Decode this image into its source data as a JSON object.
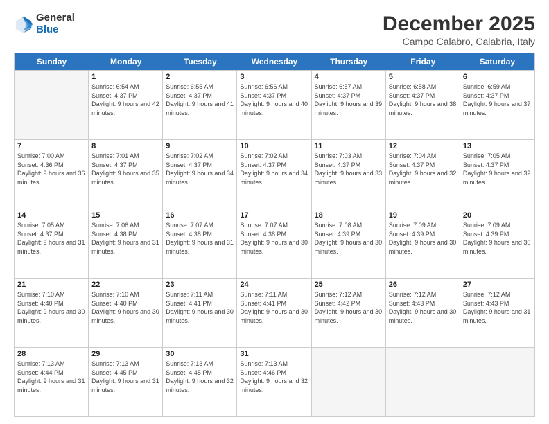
{
  "logo": {
    "general": "General",
    "blue": "Blue"
  },
  "title": "December 2025",
  "location": "Campo Calabro, Calabria, Italy",
  "header_days": [
    "Sunday",
    "Monday",
    "Tuesday",
    "Wednesday",
    "Thursday",
    "Friday",
    "Saturday"
  ],
  "weeks": [
    [
      {
        "day": "",
        "empty": true
      },
      {
        "day": "1",
        "sunrise": "6:54 AM",
        "sunset": "4:37 PM",
        "daylight": "9 hours and 42 minutes."
      },
      {
        "day": "2",
        "sunrise": "6:55 AM",
        "sunset": "4:37 PM",
        "daylight": "9 hours and 41 minutes."
      },
      {
        "day": "3",
        "sunrise": "6:56 AM",
        "sunset": "4:37 PM",
        "daylight": "9 hours and 40 minutes."
      },
      {
        "day": "4",
        "sunrise": "6:57 AM",
        "sunset": "4:37 PM",
        "daylight": "9 hours and 39 minutes."
      },
      {
        "day": "5",
        "sunrise": "6:58 AM",
        "sunset": "4:37 PM",
        "daylight": "9 hours and 38 minutes."
      },
      {
        "day": "6",
        "sunrise": "6:59 AM",
        "sunset": "4:37 PM",
        "daylight": "9 hours and 37 minutes."
      }
    ],
    [
      {
        "day": "7",
        "sunrise": "7:00 AM",
        "sunset": "4:36 PM",
        "daylight": "9 hours and 36 minutes."
      },
      {
        "day": "8",
        "sunrise": "7:01 AM",
        "sunset": "4:37 PM",
        "daylight": "9 hours and 35 minutes."
      },
      {
        "day": "9",
        "sunrise": "7:02 AM",
        "sunset": "4:37 PM",
        "daylight": "9 hours and 34 minutes."
      },
      {
        "day": "10",
        "sunrise": "7:02 AM",
        "sunset": "4:37 PM",
        "daylight": "9 hours and 34 minutes."
      },
      {
        "day": "11",
        "sunrise": "7:03 AM",
        "sunset": "4:37 PM",
        "daylight": "9 hours and 33 minutes."
      },
      {
        "day": "12",
        "sunrise": "7:04 AM",
        "sunset": "4:37 PM",
        "daylight": "9 hours and 32 minutes."
      },
      {
        "day": "13",
        "sunrise": "7:05 AM",
        "sunset": "4:37 PM",
        "daylight": "9 hours and 32 minutes."
      }
    ],
    [
      {
        "day": "14",
        "sunrise": "7:05 AM",
        "sunset": "4:37 PM",
        "daylight": "9 hours and 31 minutes."
      },
      {
        "day": "15",
        "sunrise": "7:06 AM",
        "sunset": "4:38 PM",
        "daylight": "9 hours and 31 minutes."
      },
      {
        "day": "16",
        "sunrise": "7:07 AM",
        "sunset": "4:38 PM",
        "daylight": "9 hours and 31 minutes."
      },
      {
        "day": "17",
        "sunrise": "7:07 AM",
        "sunset": "4:38 PM",
        "daylight": "9 hours and 30 minutes."
      },
      {
        "day": "18",
        "sunrise": "7:08 AM",
        "sunset": "4:39 PM",
        "daylight": "9 hours and 30 minutes."
      },
      {
        "day": "19",
        "sunrise": "7:09 AM",
        "sunset": "4:39 PM",
        "daylight": "9 hours and 30 minutes."
      },
      {
        "day": "20",
        "sunrise": "7:09 AM",
        "sunset": "4:39 PM",
        "daylight": "9 hours and 30 minutes."
      }
    ],
    [
      {
        "day": "21",
        "sunrise": "7:10 AM",
        "sunset": "4:40 PM",
        "daylight": "9 hours and 30 minutes."
      },
      {
        "day": "22",
        "sunrise": "7:10 AM",
        "sunset": "4:40 PM",
        "daylight": "9 hours and 30 minutes."
      },
      {
        "day": "23",
        "sunrise": "7:11 AM",
        "sunset": "4:41 PM",
        "daylight": "9 hours and 30 minutes."
      },
      {
        "day": "24",
        "sunrise": "7:11 AM",
        "sunset": "4:41 PM",
        "daylight": "9 hours and 30 minutes."
      },
      {
        "day": "25",
        "sunrise": "7:12 AM",
        "sunset": "4:42 PM",
        "daylight": "9 hours and 30 minutes."
      },
      {
        "day": "26",
        "sunrise": "7:12 AM",
        "sunset": "4:43 PM",
        "daylight": "9 hours and 30 minutes."
      },
      {
        "day": "27",
        "sunrise": "7:12 AM",
        "sunset": "4:43 PM",
        "daylight": "9 hours and 31 minutes."
      }
    ],
    [
      {
        "day": "28",
        "sunrise": "7:13 AM",
        "sunset": "4:44 PM",
        "daylight": "9 hours and 31 minutes."
      },
      {
        "day": "29",
        "sunrise": "7:13 AM",
        "sunset": "4:45 PM",
        "daylight": "9 hours and 31 minutes."
      },
      {
        "day": "30",
        "sunrise": "7:13 AM",
        "sunset": "4:45 PM",
        "daylight": "9 hours and 32 minutes."
      },
      {
        "day": "31",
        "sunrise": "7:13 AM",
        "sunset": "4:46 PM",
        "daylight": "9 hours and 32 minutes."
      },
      {
        "day": "",
        "empty": true
      },
      {
        "day": "",
        "empty": true
      },
      {
        "day": "",
        "empty": true
      }
    ]
  ]
}
